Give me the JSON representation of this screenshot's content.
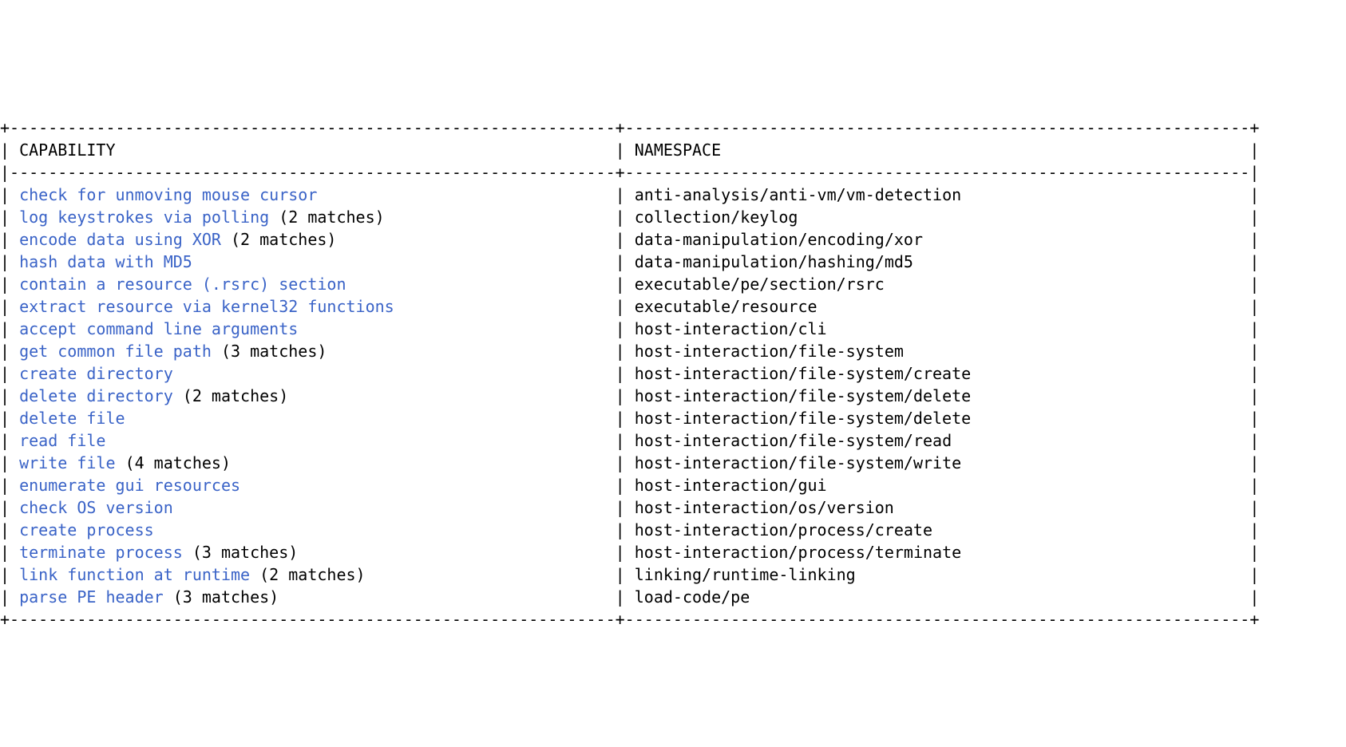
{
  "headers": {
    "capability": "CAPABILITY",
    "namespace": "NAMESPACE"
  },
  "columns": {
    "left_inner_width": 63,
    "right_inner_width": 65
  },
  "rows": [
    {
      "capability": "check for unmoving mouse cursor",
      "matches": "",
      "namespace": "anti-analysis/anti-vm/vm-detection"
    },
    {
      "capability": "log keystrokes via polling",
      "matches": "(2 matches)",
      "namespace": "collection/keylog"
    },
    {
      "capability": "encode data using XOR",
      "matches": "(2 matches)",
      "namespace": "data-manipulation/encoding/xor"
    },
    {
      "capability": "hash data with MD5",
      "matches": "",
      "namespace": "data-manipulation/hashing/md5"
    },
    {
      "capability": "contain a resource (.rsrc) section",
      "matches": "",
      "namespace": "executable/pe/section/rsrc"
    },
    {
      "capability": "extract resource via kernel32 functions",
      "matches": "",
      "namespace": "executable/resource"
    },
    {
      "capability": "accept command line arguments",
      "matches": "",
      "namespace": "host-interaction/cli"
    },
    {
      "capability": "get common file path",
      "matches": "(3 matches)",
      "namespace": "host-interaction/file-system"
    },
    {
      "capability": "create directory",
      "matches": "",
      "namespace": "host-interaction/file-system/create"
    },
    {
      "capability": "delete directory",
      "matches": "(2 matches)",
      "namespace": "host-interaction/file-system/delete"
    },
    {
      "capability": "delete file",
      "matches": "",
      "namespace": "host-interaction/file-system/delete"
    },
    {
      "capability": "read file",
      "matches": "",
      "namespace": "host-interaction/file-system/read"
    },
    {
      "capability": "write file",
      "matches": "(4 matches)",
      "namespace": "host-interaction/file-system/write"
    },
    {
      "capability": "enumerate gui resources",
      "matches": "",
      "namespace": "host-interaction/gui"
    },
    {
      "capability": "check OS version",
      "matches": "",
      "namespace": "host-interaction/os/version"
    },
    {
      "capability": "create process",
      "matches": "",
      "namespace": "host-interaction/process/create"
    },
    {
      "capability": "terminate process",
      "matches": "(3 matches)",
      "namespace": "host-interaction/process/terminate"
    },
    {
      "capability": "link function at runtime",
      "matches": "(2 matches)",
      "namespace": "linking/runtime-linking"
    },
    {
      "capability": "parse PE header",
      "matches": "(3 matches)",
      "namespace": "load-code/pe"
    }
  ]
}
